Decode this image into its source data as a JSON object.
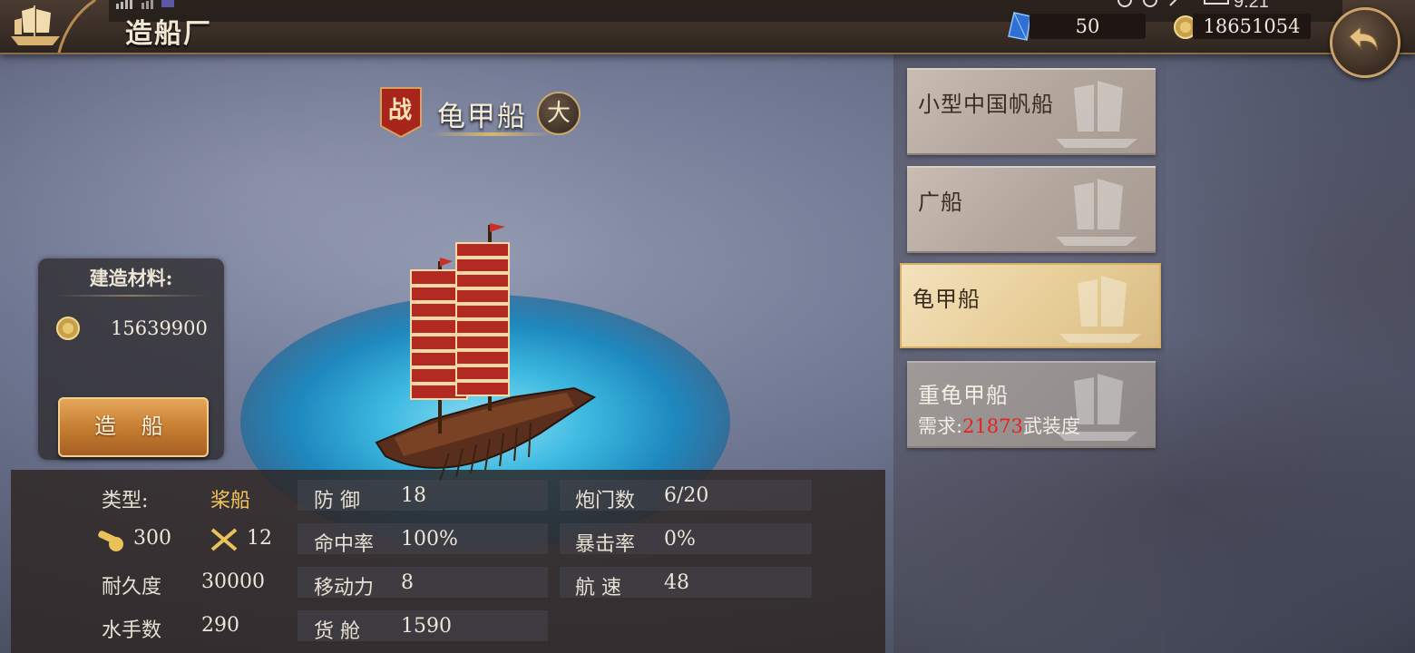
{
  "header": {
    "title": "造船厂",
    "gems": "50",
    "coins": "18651054",
    "time": "9:21"
  },
  "ship": {
    "badge": "战",
    "name": "龟甲船",
    "size": "大"
  },
  "materials": {
    "title": "建造材料:",
    "coin_amount": "15639900",
    "build_button": "造 船"
  },
  "stats": {
    "type_label": "类型:",
    "type_value": "桨船",
    "cargo_icon_value": "300",
    "swords_icon_value": "12",
    "durability_label": "耐久度",
    "durability_value": "30000",
    "sailors_label": "水手数",
    "sailors_value": "290",
    "defense_label": "防 御",
    "defense_value": "18",
    "hit_label": "命中率",
    "hit_value": "100%",
    "mobility_label": "移动力",
    "mobility_value": "8",
    "hold_label": "货 舱",
    "hold_value": "1590",
    "gunports_label": "炮门数",
    "gunports_value": "6/20",
    "crit_label": "暴击率",
    "crit_value": "0%",
    "speed_label": "航 速",
    "speed_value": "48"
  },
  "ship_list": [
    {
      "label": "小型中国帆船"
    },
    {
      "label": "广船"
    },
    {
      "label": "龟甲船",
      "selected": true
    },
    {
      "label": "重龟甲船",
      "req_prefix": "需求:",
      "req_value": "21873",
      "req_suffix": "武装度"
    }
  ],
  "colors": {
    "accent_gold": "#f4c258",
    "requirement_red": "#e82020",
    "button_orange": "#c77f33"
  },
  "icons": {
    "logo": "ship-logo-icon",
    "gem": "blue-gem-icon",
    "coin": "gold-coin-icon",
    "back": "back-arrow-icon",
    "cargo": "cannon-icon",
    "swords": "crossed-swords-icon"
  }
}
